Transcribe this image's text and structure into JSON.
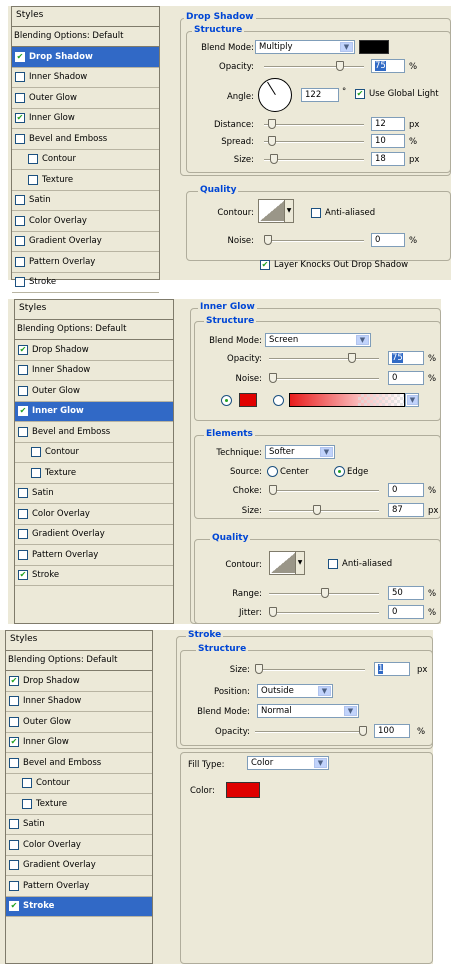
{
  "styles_list": {
    "title": "Styles",
    "blending": "Blending Options: Default",
    "items": [
      "Drop Shadow",
      "Inner Shadow",
      "Outer Glow",
      "Inner Glow",
      "Bevel and Emboss",
      "Contour",
      "Texture",
      "Satin",
      "Color Overlay",
      "Gradient Overlay",
      "Pattern Overlay",
      "Stroke"
    ]
  },
  "panel1": {
    "section_title": "Drop Shadow",
    "structure_title": "Structure",
    "checked": [
      "Drop Shadow",
      "Inner Glow"
    ],
    "selected": "Drop Shadow",
    "blend_mode_label": "Blend Mode:",
    "blend_mode": "Multiply",
    "blend_color": "#000000",
    "opacity_label": "Opacity:",
    "opacity": "75",
    "angle_label": "Angle:",
    "angle": "122",
    "degree_symbol": "°",
    "use_global_light": "Use Global Light",
    "distance_label": "Distance:",
    "distance": "12",
    "spread_label": "Spread:",
    "spread": "10",
    "size_label": "Size:",
    "size": "18",
    "quality_title": "Quality",
    "contour_label": "Contour:",
    "anti_aliased": "Anti-aliased",
    "noise_label": "Noise:",
    "noise": "0",
    "knocks_out": "Layer Knocks Out Drop Shadow",
    "unit_percent": "%",
    "unit_px": "px"
  },
  "panel2": {
    "section_title": "Inner Glow",
    "structure_title": "Structure",
    "checked": [
      "Drop Shadow",
      "Inner Glow",
      "Stroke"
    ],
    "selected": "Inner Glow",
    "blend_mode_label": "Blend Mode:",
    "blend_mode": "Screen",
    "opacity_label": "Opacity:",
    "opacity": "75",
    "noise_label": "Noise:",
    "noise": "0",
    "glow_color": "#e00000",
    "elements_title": "Elements",
    "technique_label": "Technique:",
    "technique": "Softer",
    "source_label": "Source:",
    "source_center": "Center",
    "source_edge": "Edge",
    "choke_label": "Choke:",
    "choke": "0",
    "size_label": "Size:",
    "size": "87",
    "quality_title": "Quality",
    "contour_label": "Contour:",
    "anti_aliased": "Anti-aliased",
    "range_label": "Range:",
    "range": "50",
    "jitter_label": "Jitter:",
    "jitter": "0",
    "unit_percent": "%",
    "unit_px": "px"
  },
  "panel3": {
    "section_title": "Stroke",
    "structure_title": "Structure",
    "checked": [
      "Drop Shadow",
      "Inner Glow",
      "Stroke"
    ],
    "selected": "Stroke",
    "size_label": "Size:",
    "size": "1",
    "position_label": "Position:",
    "position": "Outside",
    "blend_mode_label": "Blend Mode:",
    "blend_mode": "Normal",
    "opacity_label": "Opacity:",
    "opacity": "100",
    "fill_type_label": "Fill Type:",
    "fill_type": "Color",
    "color_label": "Color:",
    "stroke_color": "#e00000",
    "unit_percent": "%",
    "unit_px": "px"
  }
}
